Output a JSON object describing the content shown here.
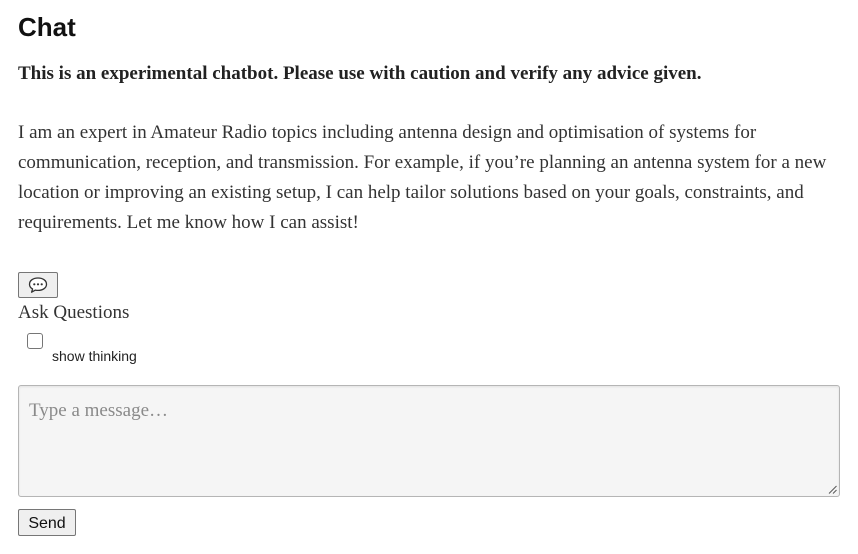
{
  "page": {
    "title": "Chat",
    "warning": "This is an experimental chatbot. Please use with caution and verify any advice given.",
    "intro": "I am an expert in Amateur Radio topics including antenna design and optimisation of systems for communication, reception, and transmission. For example, if you’re planning an antenna system for a new location or improving an existing setup, I can help tailor solutions based on your goals, constraints, and requirements. Let me know how I can assist!"
  },
  "controls": {
    "chat_toggle_icon": "speech-bubble-icon",
    "ask_label": "Ask Questions",
    "show_thinking_label": "show thinking",
    "show_thinking_checked": false
  },
  "composer": {
    "placeholder": "Type a message…",
    "send_label": "Send"
  }
}
